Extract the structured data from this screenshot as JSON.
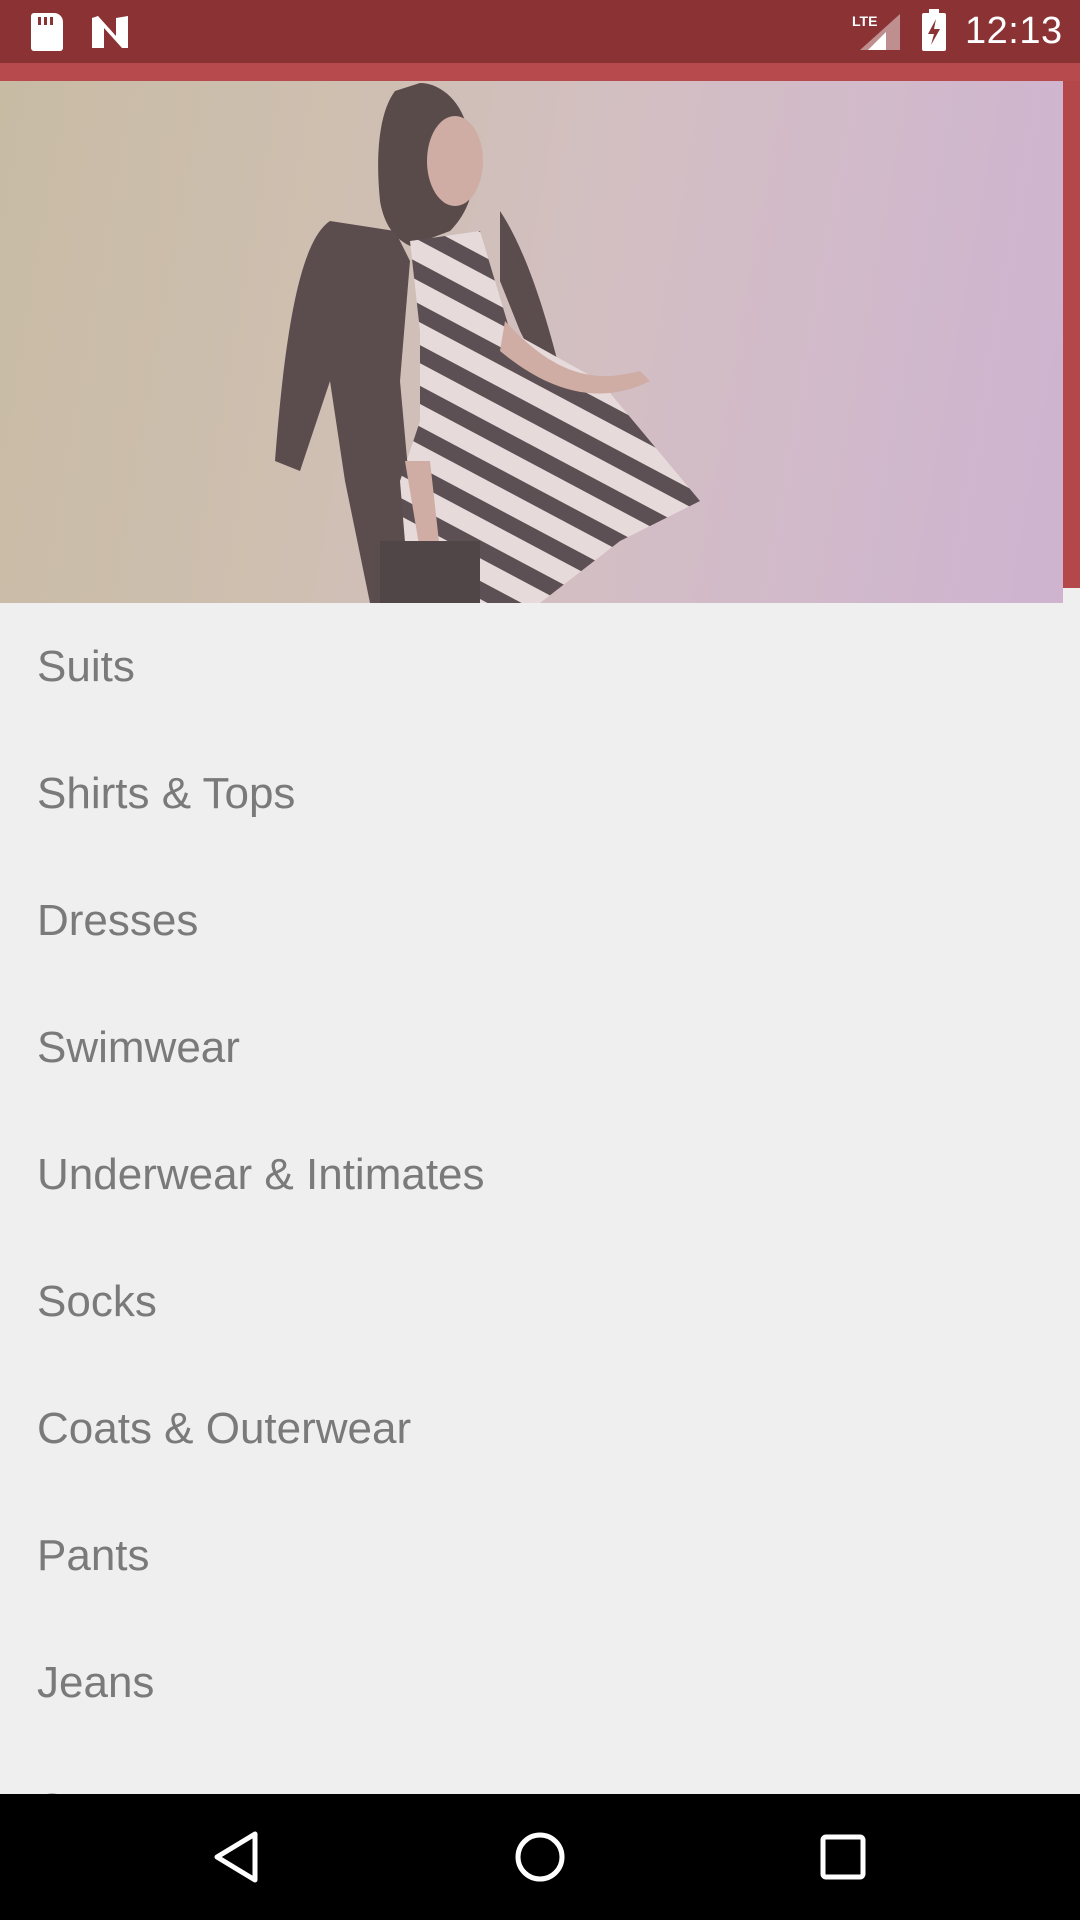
{
  "status_bar": {
    "time": "12:13",
    "network": "LTE",
    "icons": [
      "sd-card-icon",
      "n-notification-icon",
      "lte-signal-icon",
      "battery-charging-icon"
    ]
  },
  "hero": {
    "description_icon": "hero-image"
  },
  "categories": [
    {
      "label": "Suits"
    },
    {
      "label": "Shirts & Tops"
    },
    {
      "label": "Dresses"
    },
    {
      "label": "Swimwear"
    },
    {
      "label": "Underwear & Intimates"
    },
    {
      "label": "Socks"
    },
    {
      "label": "Coats & Outerwear"
    },
    {
      "label": "Pants"
    },
    {
      "label": "Jeans"
    },
    {
      "label": "Sweaters"
    }
  ],
  "nav_bar": {
    "icons": [
      "back-icon",
      "home-icon",
      "recents-icon"
    ]
  },
  "colors": {
    "status_bar": "#8b3234",
    "app_bar": "#b3474a",
    "list_bg": "#efeff0",
    "item_text": "#7a7a7a"
  }
}
